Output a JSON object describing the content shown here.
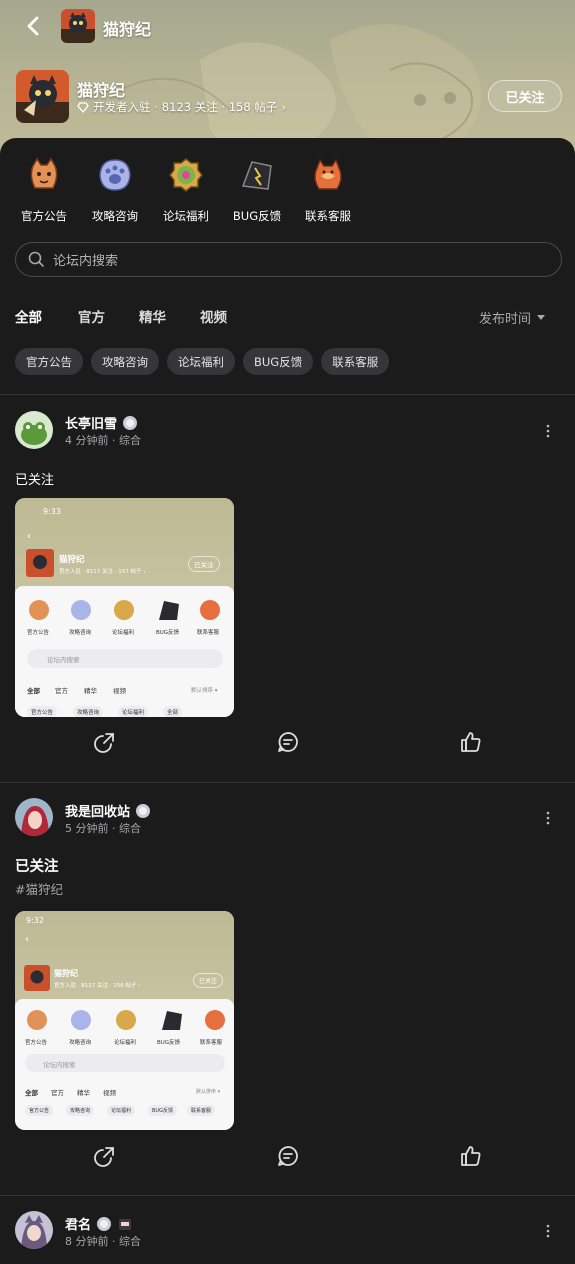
{
  "header": {
    "title": "猫狩纪",
    "game_name": "猫狩纪",
    "developer_badge": "开发者入驻",
    "stats": "· 8123 关注 · 158 帖子",
    "follow_label": "已关注"
  },
  "categories": [
    {
      "label": "官方公告",
      "icon": "ginger-cat-icon"
    },
    {
      "label": "攻略咨询",
      "icon": "paw-icon"
    },
    {
      "label": "论坛福利",
      "icon": "medal-icon"
    },
    {
      "label": "BUG反馈",
      "icon": "crystal-icon"
    },
    {
      "label": "联系客服",
      "icon": "fish-cat-icon"
    }
  ],
  "search": {
    "placeholder": "论坛内搜索"
  },
  "tabs": [
    "全部",
    "官方",
    "精华",
    "视频"
  ],
  "sort_label": "发布时间",
  "chips": [
    "官方公告",
    "攻略咨询",
    "论坛福利",
    "BUG反馈",
    "联系客服"
  ],
  "posts": [
    {
      "user": "长亭旧雪",
      "time": "4 分钟前 · 综合",
      "text": "已关注",
      "tag": "",
      "shot": {
        "status_time": "9:33",
        "game": "猫狩纪",
        "follow": "已关注",
        "meta": "官方入驻 · 8117 关注 · 157 帖子 ›",
        "cats": [
          "官方公告",
          "攻略咨询",
          "论坛福利",
          "BUG反馈",
          "联系客服"
        ],
        "search": "论坛内搜索",
        "tabs": [
          "全部",
          "官方",
          "精华",
          "视频"
        ],
        "sort": "默认排序 ▾",
        "chips": [
          "官方公告",
          "攻略咨询",
          "论坛福利",
          "全部"
        ]
      }
    },
    {
      "user": "我是回收站",
      "time": "5 分钟前 · 综合",
      "text": "已关注",
      "tag": "#猫狩纪",
      "shot": {
        "status_time": "9:32",
        "game": "猫狩纪",
        "follow": "已关注",
        "meta": "官方入驻 · 8117 关注 · 156 帖子 ›",
        "cats": [
          "官方公告",
          "攻略咨询",
          "论坛福利",
          "BUG反馈",
          "联系客服"
        ],
        "search": "论坛内搜索",
        "tabs": [
          "全部",
          "官方",
          "精华",
          "视频"
        ],
        "sort": "默认排序 ▾",
        "chips": [
          "官方公告",
          "攻略咨询",
          "论坛福利",
          "BUG反馈",
          "联系客服"
        ]
      }
    },
    {
      "user": "君名",
      "time": "8 分钟前 · 综合"
    }
  ],
  "colors": {
    "background": "#1b1b1c",
    "chip": "#363638",
    "accent": "#1fd6c0",
    "banner": "#b6b494"
  }
}
